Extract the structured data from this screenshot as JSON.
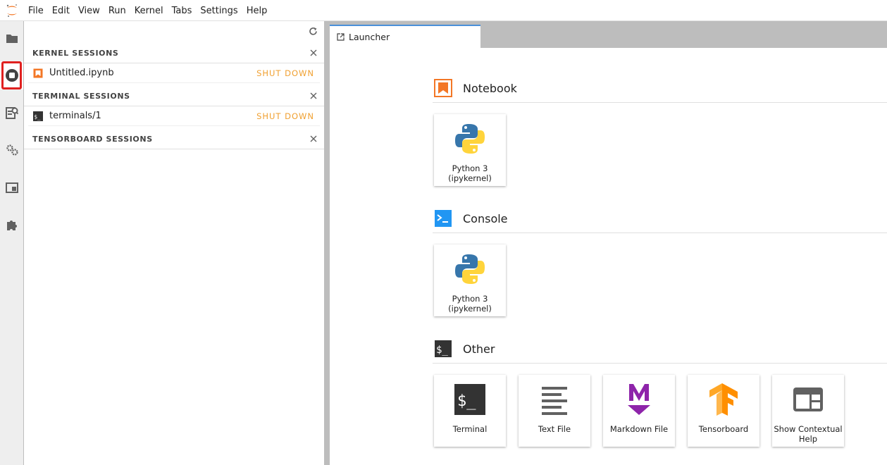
{
  "menubar": {
    "items": [
      "File",
      "Edit",
      "View",
      "Run",
      "Kernel",
      "Tabs",
      "Settings",
      "Help"
    ]
  },
  "activity_bar": {
    "icons": [
      "folder-icon",
      "running-sessions-icon",
      "property-inspector-icon",
      "settings-gear-icon",
      "tabs-icon",
      "extension-puzzle-icon"
    ]
  },
  "sidebar": {
    "kernel_sessions": {
      "title": "KERNEL SESSIONS",
      "items": [
        {
          "label": "Untitled.ipynb",
          "action": "SHUT DOWN"
        }
      ]
    },
    "terminal_sessions": {
      "title": "TERMINAL SESSIONS",
      "items": [
        {
          "label": "terminals/1",
          "action": "SHUT DOWN"
        }
      ]
    },
    "tensorboard_sessions": {
      "title": "TENSORBOARD SESSIONS"
    }
  },
  "tabs": [
    {
      "label": "Launcher"
    }
  ],
  "launcher": {
    "sections": [
      {
        "title": "Notebook",
        "cards": [
          {
            "label": "Python 3 (ipykernel)"
          }
        ]
      },
      {
        "title": "Console",
        "cards": [
          {
            "label": "Python 3 (ipykernel)"
          }
        ]
      },
      {
        "title": "Other",
        "cards": [
          {
            "label": "Terminal"
          },
          {
            "label": "Text File"
          },
          {
            "label": "Markdown File"
          },
          {
            "label": "Tensorboard"
          },
          {
            "label": "Show Contextual Help"
          }
        ]
      }
    ]
  },
  "colors": {
    "accent": "#f37726",
    "shutdown": "#f0a030",
    "highlight_box": "#e0201f",
    "console_blue": "#2196f3",
    "markdown_purple": "#8e24aa",
    "tab_active_border": "#4a90d9"
  }
}
